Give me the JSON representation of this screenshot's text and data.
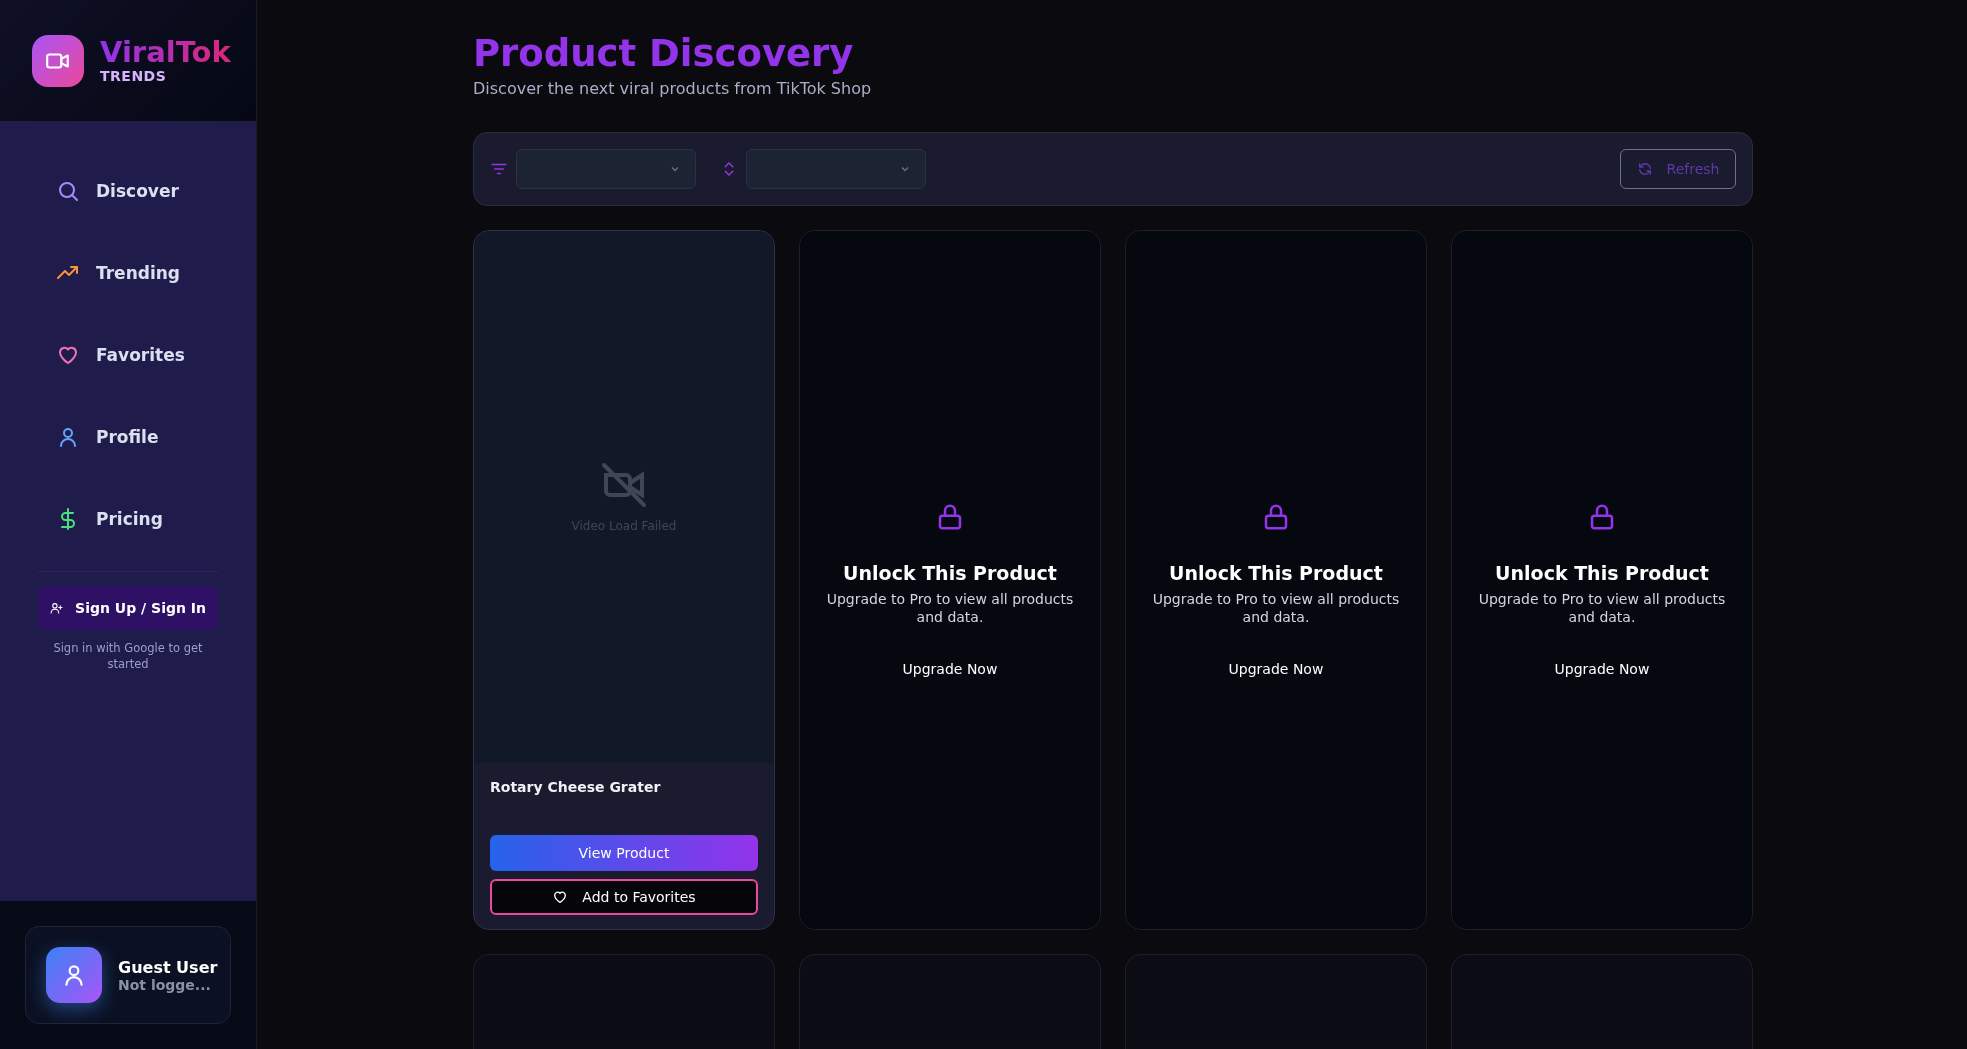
{
  "brand": {
    "name": "ViralTok",
    "tagline": "TRENDS"
  },
  "nav": [
    {
      "label": "Discover"
    },
    {
      "label": "Trending"
    },
    {
      "label": "Favorites"
    },
    {
      "label": "Profile"
    },
    {
      "label": "Pricing"
    }
  ],
  "auth": {
    "button": "Sign Up / Sign In",
    "hint": "Sign in with Google to get started"
  },
  "user": {
    "name": "Guest User",
    "status": "Not logge..."
  },
  "header": {
    "title": "Product Discovery",
    "subtitle": "Discover the next viral products from TikTok Shop"
  },
  "toolbar": {
    "refresh": "Refresh"
  },
  "cards": [
    {
      "kind": "product",
      "media_error": "Video Load Failed",
      "title": "Rotary Cheese Grater",
      "view": "View Product",
      "favorite": "Add to Favorites"
    },
    {
      "kind": "locked",
      "heading": "Unlock This Product",
      "message": "Upgrade to Pro to view all products and data.",
      "action": "Upgrade Now"
    },
    {
      "kind": "locked",
      "heading": "Unlock This Product",
      "message": "Upgrade to Pro to view all products and data.",
      "action": "Upgrade Now"
    },
    {
      "kind": "locked",
      "heading": "Unlock This Product",
      "message": "Upgrade to Pro to view all products and data.",
      "action": "Upgrade Now"
    },
    {
      "kind": "empty"
    },
    {
      "kind": "empty"
    },
    {
      "kind": "empty"
    },
    {
      "kind": "empty"
    }
  ]
}
